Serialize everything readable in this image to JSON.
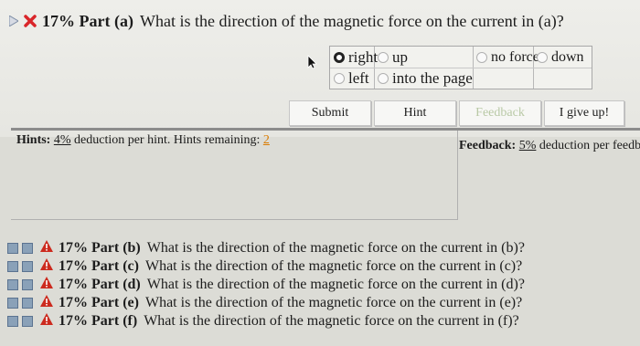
{
  "header": {
    "prefix": "17% Part (a)",
    "question": "What is the direction of the magnetic force on the current in (a)?"
  },
  "options": {
    "right": "right",
    "up": "up",
    "no_force": "no force",
    "down": "down",
    "left": "left",
    "into": "into the page",
    "selected": "right"
  },
  "buttons": {
    "submit": "Submit",
    "hint": "Hint",
    "feedback": "Feedback",
    "give_up": "I give up!"
  },
  "hints": {
    "label": "Hints:",
    "percent": "4%",
    "text": "deduction per hint. Hints remaining:",
    "remaining": "2"
  },
  "feedback": {
    "label": "Feedback:",
    "percent": "5%",
    "text": "deduction per feedb"
  },
  "parts": [
    {
      "prefix": "17% Part (b)",
      "question": "What is the direction of the magnetic force on the current in (b)?"
    },
    {
      "prefix": "17% Part (c)",
      "question": "What is the direction of the magnetic force on the current in (c)?"
    },
    {
      "prefix": "17% Part (d)",
      "question": "What is the direction of the magnetic force on the current in (d)?"
    },
    {
      "prefix": "17% Part (e)",
      "question": "What is the direction of the magnetic force on the current in (e)?"
    },
    {
      "prefix": "17% Part (f)",
      "question": "What is the direction of the magnetic force on the current in (f)?"
    }
  ],
  "colors": {
    "accent": "#d97b00",
    "error": "#d9262a",
    "warning": "#cc2a1e",
    "status_square": "#8aa1b8"
  }
}
